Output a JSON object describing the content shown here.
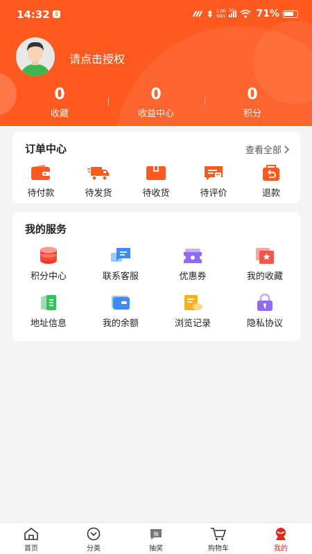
{
  "status_bar": {
    "time": "14:32",
    "notif_badge": "8",
    "net_speed_top": "1.00",
    "net_speed_bottom": "KB/s",
    "signal_label": "5G",
    "battery": "71%"
  },
  "profile": {
    "login_prompt": "请点击授权",
    "avatar_icon": "default-user-avatar"
  },
  "stats": [
    {
      "value": "0",
      "label": "收藏"
    },
    {
      "value": "0",
      "label": "收益中心"
    },
    {
      "value": "0",
      "label": "积分"
    }
  ],
  "orders": {
    "title": "订单中心",
    "view_all": "查看全部",
    "items": [
      {
        "label": "待付款",
        "icon": "wallet-icon"
      },
      {
        "label": "待发货",
        "icon": "truck-icon"
      },
      {
        "label": "待收货",
        "icon": "package-icon"
      },
      {
        "label": "待评价",
        "icon": "review-icon"
      },
      {
        "label": "退款",
        "icon": "refund-icon"
      }
    ]
  },
  "services": {
    "title": "我的服务",
    "items": [
      {
        "label": "积分中心",
        "icon": "points-icon",
        "color": "#f04a3a"
      },
      {
        "label": "联系客服",
        "icon": "chat-icon",
        "color": "#3b8cf6"
      },
      {
        "label": "优惠券",
        "icon": "coupon-icon",
        "color": "#8f6bf0"
      },
      {
        "label": "我的收藏",
        "icon": "favorites-icon",
        "color": "#f0574a"
      },
      {
        "label": "地址信息",
        "icon": "address-icon",
        "color": "#36c25a"
      },
      {
        "label": "我的余额",
        "icon": "balance-icon",
        "color": "#3b8cf6"
      },
      {
        "label": "浏览记录",
        "icon": "history-icon",
        "color": "#f5b21e"
      },
      {
        "label": "隐私协议",
        "icon": "privacy-lock-icon",
        "color": "#8f6bf0"
      }
    ]
  },
  "tabbar": {
    "active_color": "#e8251c",
    "items": [
      {
        "label": "首页",
        "icon": "home-icon"
      },
      {
        "label": "分类",
        "icon": "category-icon"
      },
      {
        "label": "抽奖",
        "icon": "lottery-icon"
      },
      {
        "label": "购物车",
        "icon": "cart-icon"
      },
      {
        "label": "我的",
        "icon": "profile-icon"
      }
    ]
  },
  "colors": {
    "brand": "#fe5a1f",
    "page_bg": "#f4f4f4",
    "icon_orange": "#fe5a1f"
  }
}
